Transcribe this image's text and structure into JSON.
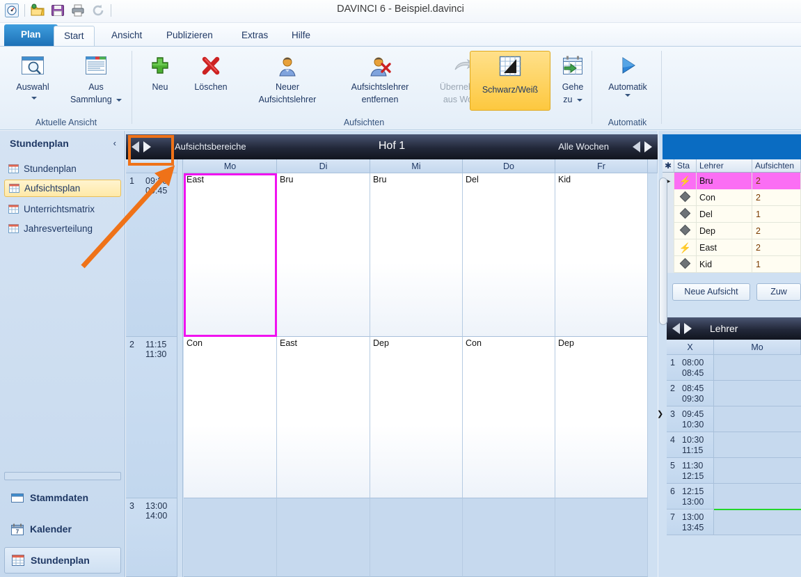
{
  "window": {
    "title": "DAVINCI 6 - Beispiel.davinci"
  },
  "quick_access": {
    "items": [
      {
        "name": "davinci-logo-icon",
        "label": "davinci"
      },
      {
        "name": "open-folder-icon",
        "label": "Öffnen"
      },
      {
        "name": "save-icon",
        "label": "Speichern"
      },
      {
        "name": "print-icon",
        "label": "Drucken"
      },
      {
        "name": "refresh-icon",
        "label": "Aktualisieren"
      }
    ]
  },
  "tabs": {
    "file_tab": "Plan",
    "items": [
      {
        "label": "Start",
        "active": true
      },
      {
        "label": "Ansicht",
        "active": false
      },
      {
        "label": "Publizieren",
        "active": false
      },
      {
        "label": "Extras",
        "active": false
      },
      {
        "label": "Hilfe",
        "active": false
      }
    ]
  },
  "ribbon": {
    "groups": [
      {
        "title": "Aktuelle Ansicht",
        "buttons": [
          {
            "label1": "Auswahl",
            "label2": "",
            "icon": "magnifier-window-icon",
            "dropdown": true,
            "selected": false,
            "disabled": false
          },
          {
            "label1": "Aus",
            "label2": "Sammlung",
            "icon": "collection-window-icon",
            "dropdown": true,
            "selected": false,
            "disabled": false
          }
        ]
      },
      {
        "title": "Aufsichten",
        "buttons": [
          {
            "label1": "Neu",
            "label2": "",
            "icon": "plus-green-icon",
            "dropdown": false,
            "selected": false,
            "disabled": false
          },
          {
            "label1": "Löschen",
            "label2": "",
            "icon": "delete-red-x-icon",
            "dropdown": false,
            "selected": false,
            "disabled": false
          },
          {
            "label1": "Neuer",
            "label2": "Aufsichtslehrer",
            "icon": "person-add-icon",
            "dropdown": false,
            "selected": false,
            "disabled": false
          },
          {
            "label1": "Aufsichtslehrer",
            "label2": "entfernen",
            "icon": "person-remove-icon",
            "dropdown": false,
            "selected": false,
            "disabled": false
          },
          {
            "label1": "Übernehmen",
            "label2": "aus Woche",
            "icon": "arrow-curve-grey-icon",
            "dropdown": false,
            "selected": false,
            "disabled": true
          },
          {
            "label1": "Schwarz/Weiß",
            "label2": "",
            "icon": "black-white-grid-icon",
            "dropdown": false,
            "selected": true,
            "disabled": false
          },
          {
            "label1": "Gehe",
            "label2": "zu",
            "icon": "calendar-goto-icon",
            "dropdown": true,
            "selected": false,
            "disabled": false
          }
        ]
      },
      {
        "title": "Automatik",
        "buttons": [
          {
            "label1": "Automatik",
            "label2": "",
            "icon": "play-blue-triangle-icon",
            "dropdown": true,
            "selected": false,
            "disabled": false
          }
        ]
      }
    ]
  },
  "sidebar": {
    "title": "Stundenplan",
    "collapse_glyph": "‹",
    "items": [
      {
        "label": "Stundenplan",
        "active": false
      },
      {
        "label": "Aufsichtsplan",
        "active": true
      },
      {
        "label": "Unterrichtsmatrix",
        "active": false
      },
      {
        "label": "Jahresverteilung",
        "active": false
      }
    ],
    "main_items": [
      {
        "label": "Stammdaten",
        "icon": "folder-icon",
        "current": false
      },
      {
        "label": "Kalender",
        "icon": "calendar-icon",
        "current": false
      },
      {
        "label": "Stundenplan",
        "icon": "grid-icon",
        "current": true
      }
    ]
  },
  "plan": {
    "header": {
      "left_label": "Aufsichtsbereiche",
      "center_label": "Hof 1",
      "right_label": "Alle Wochen",
      "prev_glyph": "◀",
      "next_glyph": "▶"
    },
    "day_columns": [
      "Mo",
      "Di",
      "Mi",
      "Do",
      "Fr"
    ],
    "rows": [
      {
        "num": "1",
        "start": "09:30",
        "end": "09:45",
        "shaded": false,
        "cells": [
          "East",
          "Bru",
          "Bru",
          "Del",
          "Kid"
        ]
      },
      {
        "num": "2",
        "start": "11:15",
        "end": "11:30",
        "shaded": false,
        "cells": [
          "Con",
          "East",
          "Dep",
          "Con",
          "Dep"
        ]
      },
      {
        "num": "3",
        "start": "13:00",
        "end": "14:00",
        "shaded": true,
        "cells": [
          "",
          "",
          "",
          "",
          ""
        ]
      }
    ],
    "selected_cell": {
      "row": 0,
      "col": 0,
      "value": "East"
    }
  },
  "right_panel": {
    "teachers_table": {
      "columns": [
        "✱",
        "Sta",
        "Lehrer",
        "Aufsichten"
      ],
      "rows": [
        {
          "marker": "▶",
          "status": "bolt",
          "name": "Bru",
          "count": "2",
          "selected": true
        },
        {
          "marker": "",
          "status": "diamond",
          "name": "Con",
          "count": "2",
          "selected": false
        },
        {
          "marker": "",
          "status": "diamond",
          "name": "Del",
          "count": "1",
          "selected": false
        },
        {
          "marker": "",
          "status": "diamond",
          "name": "Dep",
          "count": "2",
          "selected": false
        },
        {
          "marker": "",
          "status": "bolt",
          "name": "East",
          "count": "2",
          "selected": false
        },
        {
          "marker": "",
          "status": "diamond",
          "name": "Kid",
          "count": "1",
          "selected": false
        }
      ]
    },
    "buttons": [
      {
        "label": "Neue Aufsicht"
      },
      {
        "label": "Zuw"
      }
    ],
    "lehrer_panel": {
      "title": "Lehrer",
      "prev_glyph": "◀",
      "next_glyph": "▶",
      "columns": [
        "X",
        "Mo"
      ],
      "rows": [
        {
          "num": "1",
          "start": "08:00",
          "end": "08:45",
          "greenline": false
        },
        {
          "num": "2",
          "start": "08:45",
          "end": "09:30",
          "greenline": false
        },
        {
          "num": "3",
          "start": "09:45",
          "end": "10:30",
          "greenline": false
        },
        {
          "num": "4",
          "start": "10:30",
          "end": "11:15",
          "greenline": false
        },
        {
          "num": "5",
          "start": "11:30",
          "end": "12:15",
          "greenline": false
        },
        {
          "num": "6",
          "start": "12:15",
          "end": "13:00",
          "greenline": false
        },
        {
          "num": "7",
          "start": "13:00",
          "end": "13:45",
          "greenline": true
        }
      ],
      "expander_glyph": "❯"
    }
  },
  "annotation": {
    "highlight_color": "#ef7218",
    "target": "plan-header-prev-next-arrows"
  },
  "colors": {
    "accent_blue": "#1c6fb5",
    "ribbon_selected": "#fdc83f",
    "selection_magenta": "#f012f0",
    "row_selected_pink": "#fb6ef4",
    "annotation_orange": "#ef7218",
    "green_line": "#22d629"
  }
}
